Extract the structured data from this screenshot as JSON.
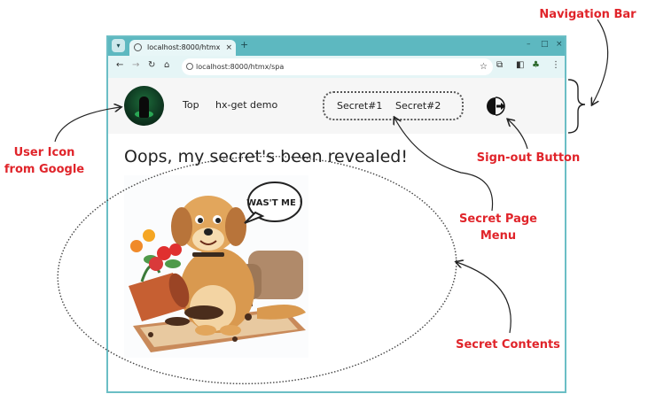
{
  "browser": {
    "tab_title": "localhost:8000/htmx",
    "tab_close": "×",
    "new_tab": "+",
    "url": "localhost:8000/htmx/spa",
    "window_controls": [
      "–",
      "□",
      "×"
    ],
    "toolbar_icons": [
      "back-arrow-icon",
      "forward-arrow-icon",
      "reload-icon",
      "home-icon",
      "extensions-icon",
      "sidebar-icon",
      "profile-tree-icon",
      "menu-dots-icon"
    ]
  },
  "navbar": {
    "links": [
      "Top",
      "hx-get demo"
    ],
    "secret_menu": [
      "Secret#1",
      "Secret#2"
    ]
  },
  "content": {
    "headline": "Oops, my secret's been revealed!",
    "speech_bubble": "WAS'T ME !"
  },
  "annotations": {
    "navigation_bar": "Navigation Bar",
    "user_icon": [
      "User Icon",
      "from Google"
    ],
    "signout_button": "Sign-out Button",
    "secret_page_menu": [
      "Secret Page",
      "Menu"
    ],
    "secret_contents": "Secret Contents"
  },
  "colors": {
    "annotation_red": "#e0242a",
    "titlebar_teal": "#5db8c0",
    "toolbar_light": "#e5f5f6",
    "navbar_bg": "#f6f6f6"
  }
}
